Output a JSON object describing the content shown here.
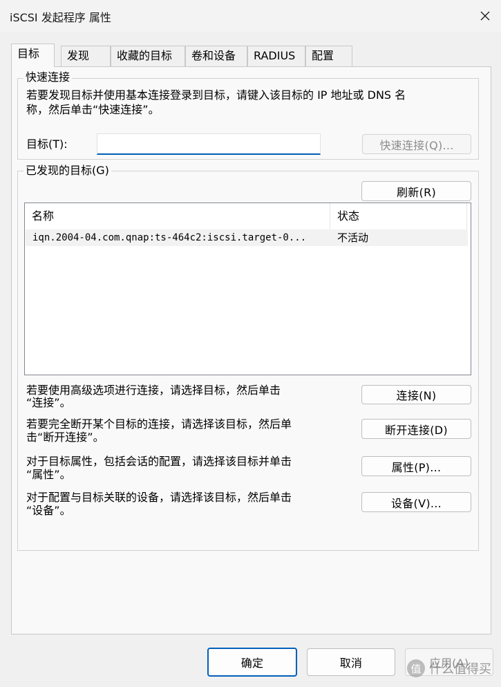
{
  "window": {
    "title": "iSCSI 发起程序 属性"
  },
  "tabs": [
    {
      "label": "目标"
    },
    {
      "label": "发现"
    },
    {
      "label": "收藏的目标"
    },
    {
      "label": "卷和设备"
    },
    {
      "label": "RADIUS"
    },
    {
      "label": "配置"
    }
  ],
  "quick_connect": {
    "group_label": "快速连接",
    "description_line1": "若要发现目标并使用基本连接登录到目标，请键入该目标的 IP 地址或 DNS 名",
    "description_line2": "称，然后单击“快速连接”。",
    "target_label": "目标(T):",
    "target_value": "",
    "button": "快速连接(Q)..."
  },
  "discovered": {
    "group_label": "已发现的目标(G)",
    "refresh_button": "刷新(R)",
    "columns": [
      "名称",
      "状态"
    ],
    "rows": [
      {
        "name": "iqn.2004-04.com.qnap:ts-464c2:iscsi.target-0...",
        "status": "不活动"
      }
    ]
  },
  "actions": [
    {
      "line1": "若要使用高级选项进行连接，请选择目标，然后单击",
      "line2": "“连接”。",
      "button": "连接(N)"
    },
    {
      "line1": "若要完全断开某个目标的连接，请选择该目标，然后单",
      "line2": "击“断开连接”。",
      "button": "断开连接(D)"
    },
    {
      "line1": "对于目标属性，包括会话的配置，请选择该目标并单击",
      "line2": "“属性”。",
      "button": "属性(P)..."
    },
    {
      "line1": "对于配置与目标关联的设备，请选择该目标，然后单击",
      "line2": "“设备”。",
      "button": "设备(V)..."
    }
  ],
  "footer": {
    "ok": "确定",
    "cancel": "取消",
    "apply": "应用(A)"
  },
  "watermark": {
    "text": "什么值得买",
    "badge": "值"
  },
  "colors": {
    "accent": "#005fb8",
    "panel": "#f9f9f9",
    "window": "#f0f0f0"
  }
}
